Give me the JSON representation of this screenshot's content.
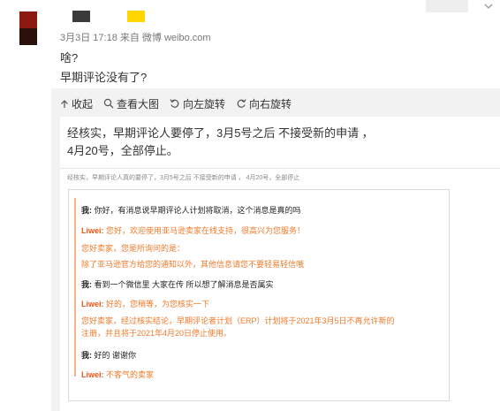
{
  "post": {
    "meta": "3月3日 17:18 来自 微博 weibo.com",
    "comment_lines": [
      "啥?",
      "早期评论没有了?"
    ]
  },
  "toolbar": {
    "collapse": "收起",
    "view_large": "查看大图",
    "rotate_left": "向左旋转",
    "rotate_right": "向右旋转"
  },
  "image": {
    "headline": "经核实，早期评论人要停了，3月5号之后 不接受新的申请 ，4月20号，全部停止。",
    "subline": "经核实，早期评论人真的要停了，3月5号之后 不接受新的申请 ， 4月20号，全部停止",
    "chat": [
      {
        "speaker": "我:",
        "text": "你好，有消息说早期评论人计划将取消，这个消息是真的吗",
        "role": "q"
      },
      {
        "speaker": "Liwei:",
        "text": "您好，欢迎使用亚马逊卖家在线支持，很高兴为您服务！",
        "role": "a"
      },
      {
        "speaker": "",
        "text": "您好卖家，您是所询问的是：",
        "role": "a"
      },
      {
        "speaker": "",
        "text": "除了亚马逊官方给您的通知以外，其他信息请您不要轻易轻信哦",
        "role": "a"
      },
      {
        "speaker": "我:",
        "text": "看到一个微信里 大家在传 所以想了解消息是否属实",
        "role": "q"
      },
      {
        "speaker": "Liwei:",
        "text": "好的，您稍等，为您核实一下",
        "role": "a"
      },
      {
        "speaker": "",
        "text": "您好卖家，经过核实结论，早期评论者计划（ERP）计划将于2021年3月5日不再允许新的",
        "role": "a"
      },
      {
        "speaker": "",
        "text": "注册，并且将于2021年4月20日停止使用。",
        "role": "a"
      },
      {
        "speaker": "我:",
        "text": "好的 谢谢你",
        "role": "q"
      },
      {
        "speaker": "Liwei:",
        "text": "不客气的卖家",
        "role": "a"
      }
    ]
  },
  "colors": {
    "accent_orange": "#f07a2a",
    "grey_background": "#f2f2f2",
    "avatar_red": "#8a1a12",
    "name_yellow": "#ffd600"
  },
  "icons": [
    "collapse-icon",
    "magnifier-icon",
    "rotate-left-icon",
    "rotate-right-icon",
    "chevron-down-icon"
  ]
}
